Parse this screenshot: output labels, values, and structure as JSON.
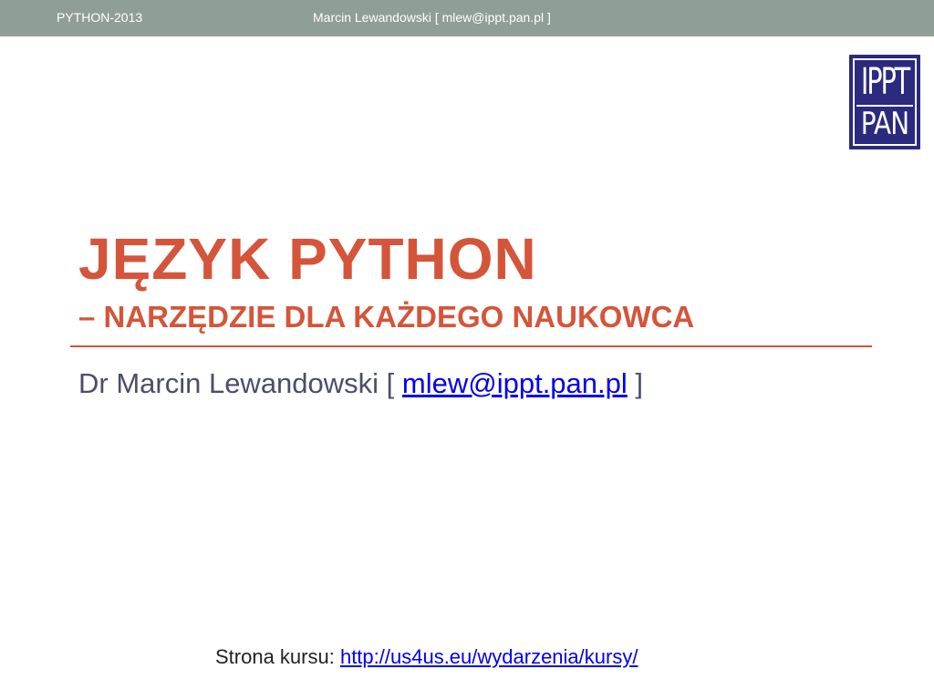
{
  "header": {
    "left_text": "PYTHON-2013",
    "right_text": "Marcin Lewandowski [ mlew@ippt.pan.pl ]"
  },
  "logo": {
    "line1": "IPPT",
    "line2": "PAN",
    "bg_color": "#2b2a7e"
  },
  "slide": {
    "title": "JĘZYK PYTHON",
    "subtitle": "– NARZĘDZIE DLA KAŻDEGO NAUKOWCA",
    "accent_color": "#d4553a",
    "author_prefix": "Dr Marcin Lewandowski [ ",
    "author_email": "mlew@ippt.pan.pl",
    "author_suffix": " ]",
    "course_label": "Strona kursu: ",
    "course_url": "http://us4us.eu/wydarzenia/kursy/"
  }
}
